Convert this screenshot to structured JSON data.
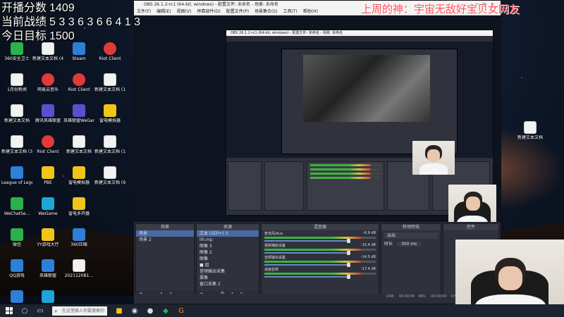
{
  "overlay": {
    "rows": [
      {
        "label": "开播分数",
        "value": "1409"
      },
      {
        "label": "当前战绩",
        "value": "5 3 3 6 3 6 6 4 1 3"
      },
      {
        "label": "今日目标",
        "value": "1500"
      }
    ],
    "banner": "上周的神：宇宙无敌好宝贝女网友"
  },
  "desktop": {
    "col1": [
      {
        "label": "360安全卫士",
        "color": "green"
      },
      {
        "label": "1月份新闻",
        "color": "doc"
      },
      {
        "label": "新建文本文档",
        "color": "doc"
      },
      {
        "label": "新建文本文档 (3)",
        "color": "doc"
      },
      {
        "label": "League of Legends",
        "color": "blue"
      },
      {
        "label": "WeChatSe...",
        "color": "green"
      },
      {
        "label": "微信",
        "color": "green"
      },
      {
        "label": "QQ游戏",
        "color": "blue"
      },
      {
        "label": "腾讯儿电脑 (1)",
        "color": "blue"
      }
    ],
    "col2": [
      {
        "label": "新建文本文档 (4)",
        "color": "doc"
      },
      {
        "label": "网易云音乐",
        "color": "netease"
      },
      {
        "label": "腾讯英雄联盟",
        "color": "purple"
      },
      {
        "label": "Riot Client",
        "color": "red"
      },
      {
        "label": "PBE",
        "color": "yellow"
      },
      {
        "label": "WeGame",
        "color": "cyan"
      },
      {
        "label": "YY游戏大厅",
        "color": "yellow"
      },
      {
        "label": "英雄联盟",
        "color": "blue"
      },
      {
        "label": "360软件管家",
        "color": "cyan"
      }
    ],
    "col3": [
      {
        "label": "Steam",
        "color": "blue"
      },
      {
        "label": "Riot Client",
        "color": "red"
      },
      {
        "label": "英雄联盟WeGame",
        "color": "purple"
      },
      {
        "label": "新建文本文档",
        "color": "doc"
      },
      {
        "label": "雷电模拟器",
        "color": "yellow"
      },
      {
        "label": "雷电多开器",
        "color": "yellow"
      },
      {
        "label": "360压缩",
        "color": "blue"
      },
      {
        "label": "2021120B1...",
        "color": "doc"
      }
    ],
    "col4": [
      {
        "label": "Riot Client",
        "color": "red"
      },
      {
        "label": "新建文本文档 (12)",
        "color": "doc"
      },
      {
        "label": "雷电模拟器",
        "color": "yellow"
      },
      {
        "label": "新建文本文档 (10)",
        "color": "doc"
      },
      {
        "label": "新建文本文档 (9)",
        "color": "doc"
      }
    ],
    "right_icon": {
      "label": "新建文本文档",
      "color": "doc"
    }
  },
  "obs": {
    "title": "OBS 26.1.2-rc1 (64-bit, windows) - 配置文件: 未命名 - 场景: 未命名",
    "menu": [
      "文件(F)",
      "编辑(E)",
      "视图(V)",
      "停靠部件(D)",
      "配置文件(P)",
      "场景集合(S)",
      "工具(T)",
      "帮助(H)"
    ],
    "scenes": {
      "header": "场景",
      "items": [
        "场景",
        "场景 2"
      ],
      "footer": "+ — ∧ ∨"
    },
    "sources": {
      "header": "来源",
      "items": [
        "文本 (GDI+) 3",
        "lih.mp",
        "图像 3",
        "图像 2",
        "图像",
        "■ 组",
        "音频输出采集",
        "摄像",
        "窗口采集 2"
      ],
      "footer": "+ — ⚙ ∧ ∨"
    },
    "mixer": {
      "header": "混音器",
      "channels": [
        {
          "name": "麦克风/Aux",
          "db": "-6.9 dB"
        },
        {
          "name": "视频捕获设备",
          "db": "-15.4 dB"
        },
        {
          "name": "音频输出采集",
          "db": "-14.5 dB"
        },
        {
          "name": "桌面音频",
          "db": "-17.4 dB"
        }
      ]
    },
    "transitions": {
      "header": "转场特效",
      "fade": "淡出",
      "duration_label": "时长",
      "duration": "300 ms"
    },
    "controls": {
      "header": "控件"
    },
    "status": "LIVE: 00:00:00   REC: 00:00:00   CPU: 5.4%, 60.00 fps"
  },
  "taskbar": {
    "search_placeholder": "在这里输入你要搜索的内容"
  }
}
